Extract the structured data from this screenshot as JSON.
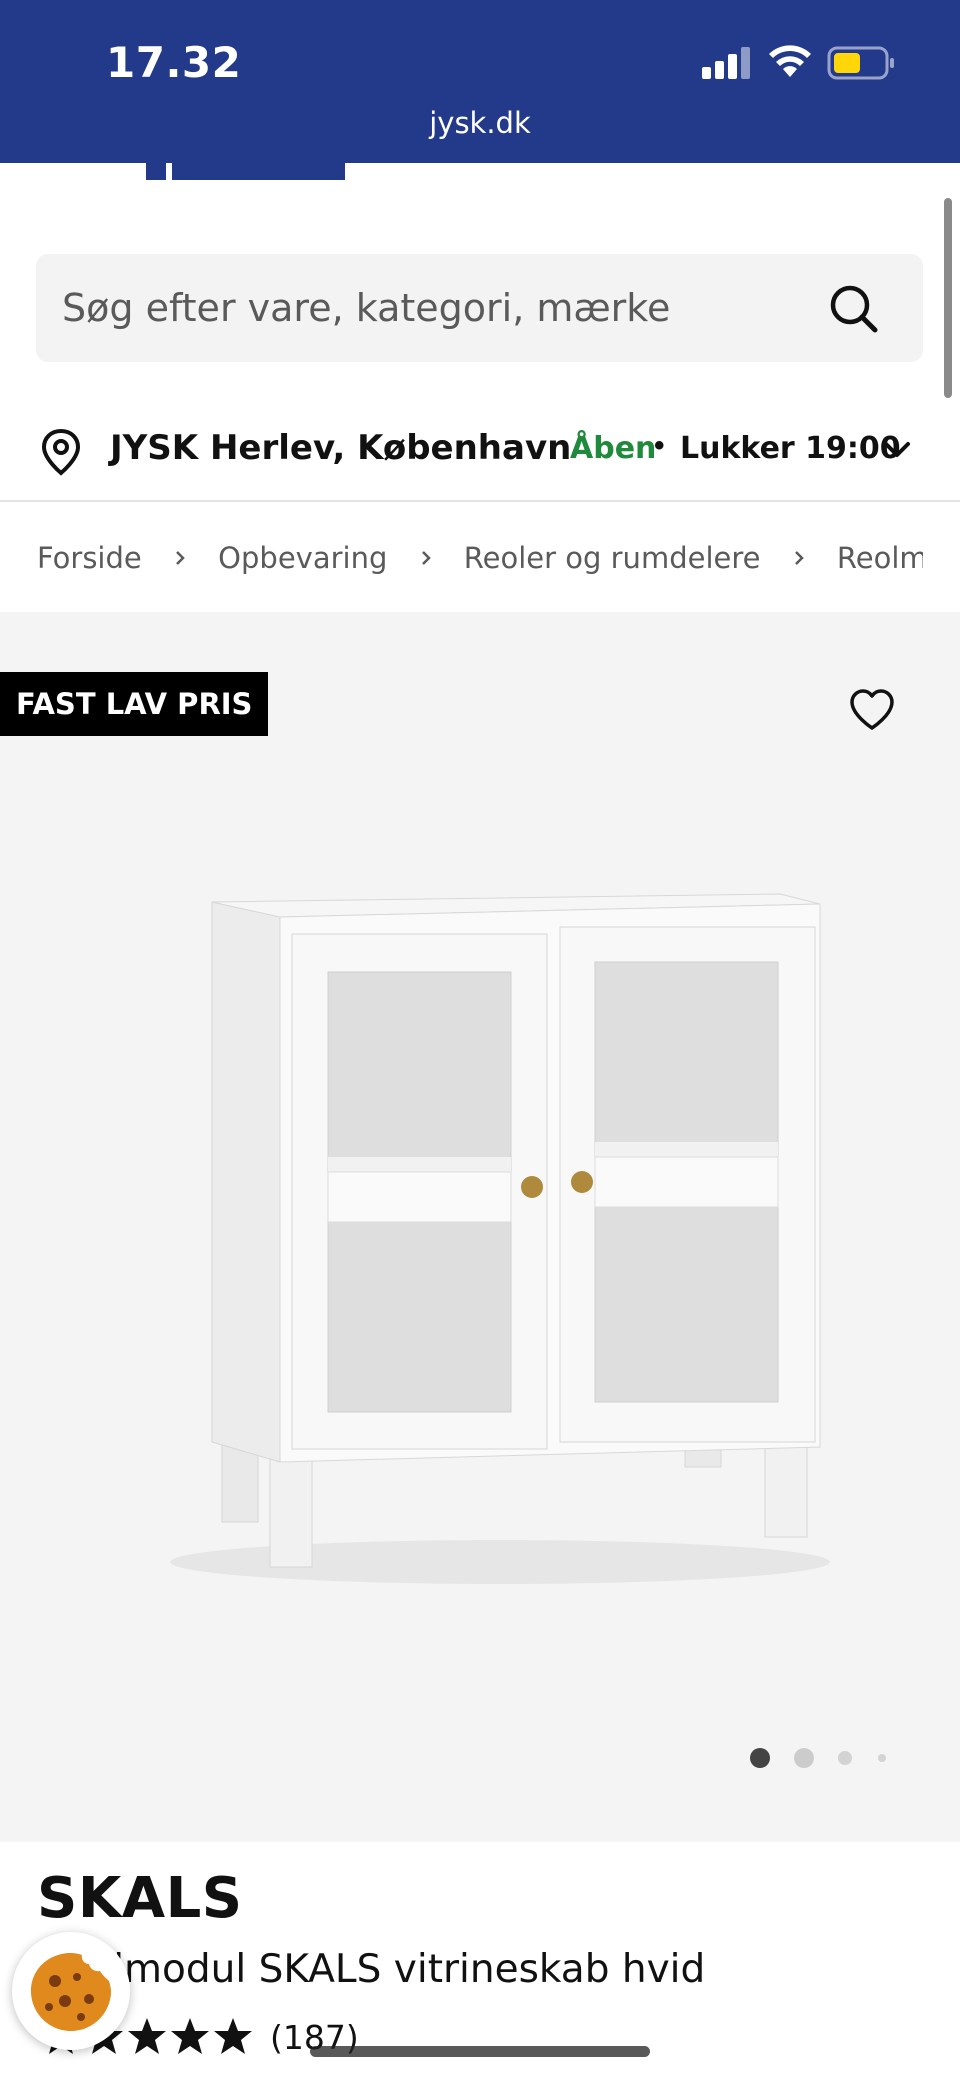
{
  "status_bar": {
    "time": "17.32",
    "url": "jysk.dk"
  },
  "search": {
    "placeholder": "Søg efter vare, kategori, mærke"
  },
  "store": {
    "name": "JYSK Herlev, København",
    "status": "Åben",
    "separator": "•",
    "closes": "Lukker 19:00"
  },
  "breadcrumb": [
    "Forside",
    "Opbevaring",
    "Reoler og rumdelere",
    "Reolmodul SKALS"
  ],
  "product": {
    "badge": "FAST LAV PRIS",
    "brand": "SKALS",
    "title": "Reolmodul SKALS vitrineskab hvid",
    "rating": 5,
    "reviews": "(187)",
    "gallery_image_count": 4,
    "gallery_active_index": 0
  },
  "colors": {
    "brand_blue": "#233a8a",
    "open_green": "#1f8a3c",
    "badge_black": "#000000",
    "gallery_bg": "#f4f4f4"
  },
  "icons": [
    "signal-icon",
    "wifi-icon",
    "battery-icon",
    "search-icon",
    "location-pin-icon",
    "chevron-down-icon",
    "chevron-right-icon",
    "heart-icon",
    "star-icon",
    "cookie-icon"
  ]
}
